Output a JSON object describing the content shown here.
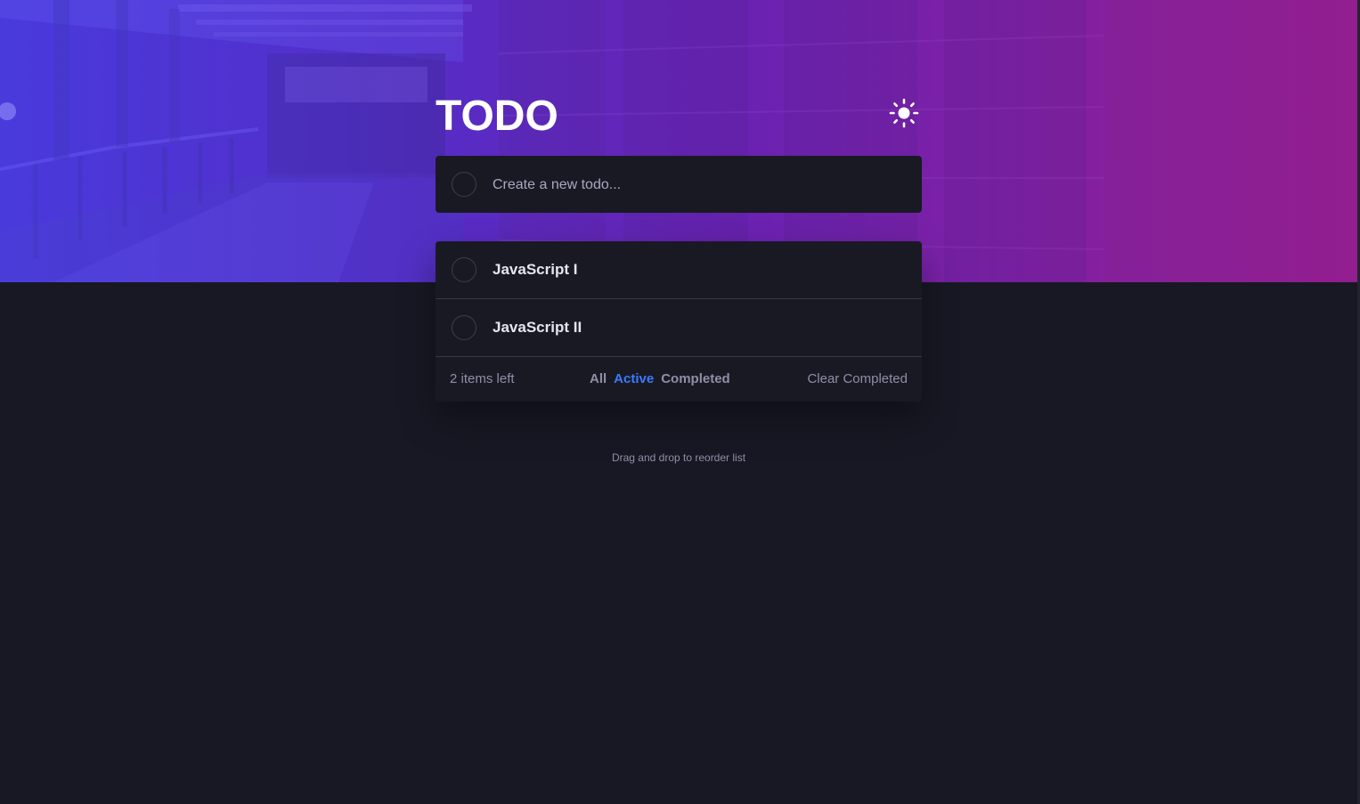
{
  "app": {
    "title": "TODO"
  },
  "theme_toggle": {
    "icon": "sun-icon"
  },
  "new_todo": {
    "placeholder": "Create a new todo..."
  },
  "todos": [
    {
      "text": "JavaScript I",
      "completed": false
    },
    {
      "text": "JavaScript II",
      "completed": false
    }
  ],
  "footer": {
    "items_left": "2 items left",
    "filters": [
      {
        "label": "All",
        "active": false
      },
      {
        "label": "Active",
        "active": true
      },
      {
        "label": "Completed",
        "active": false
      }
    ],
    "clear_label": "Clear Completed"
  },
  "hint": "Drag and drop to reorder list",
  "colors": {
    "background": "#181824",
    "card": "#191924",
    "accent": "#3a7bfd",
    "muted_text": "#8e8fa8",
    "gradient_start": "#3a1fc4",
    "gradient_end": "#8a1a8e"
  }
}
